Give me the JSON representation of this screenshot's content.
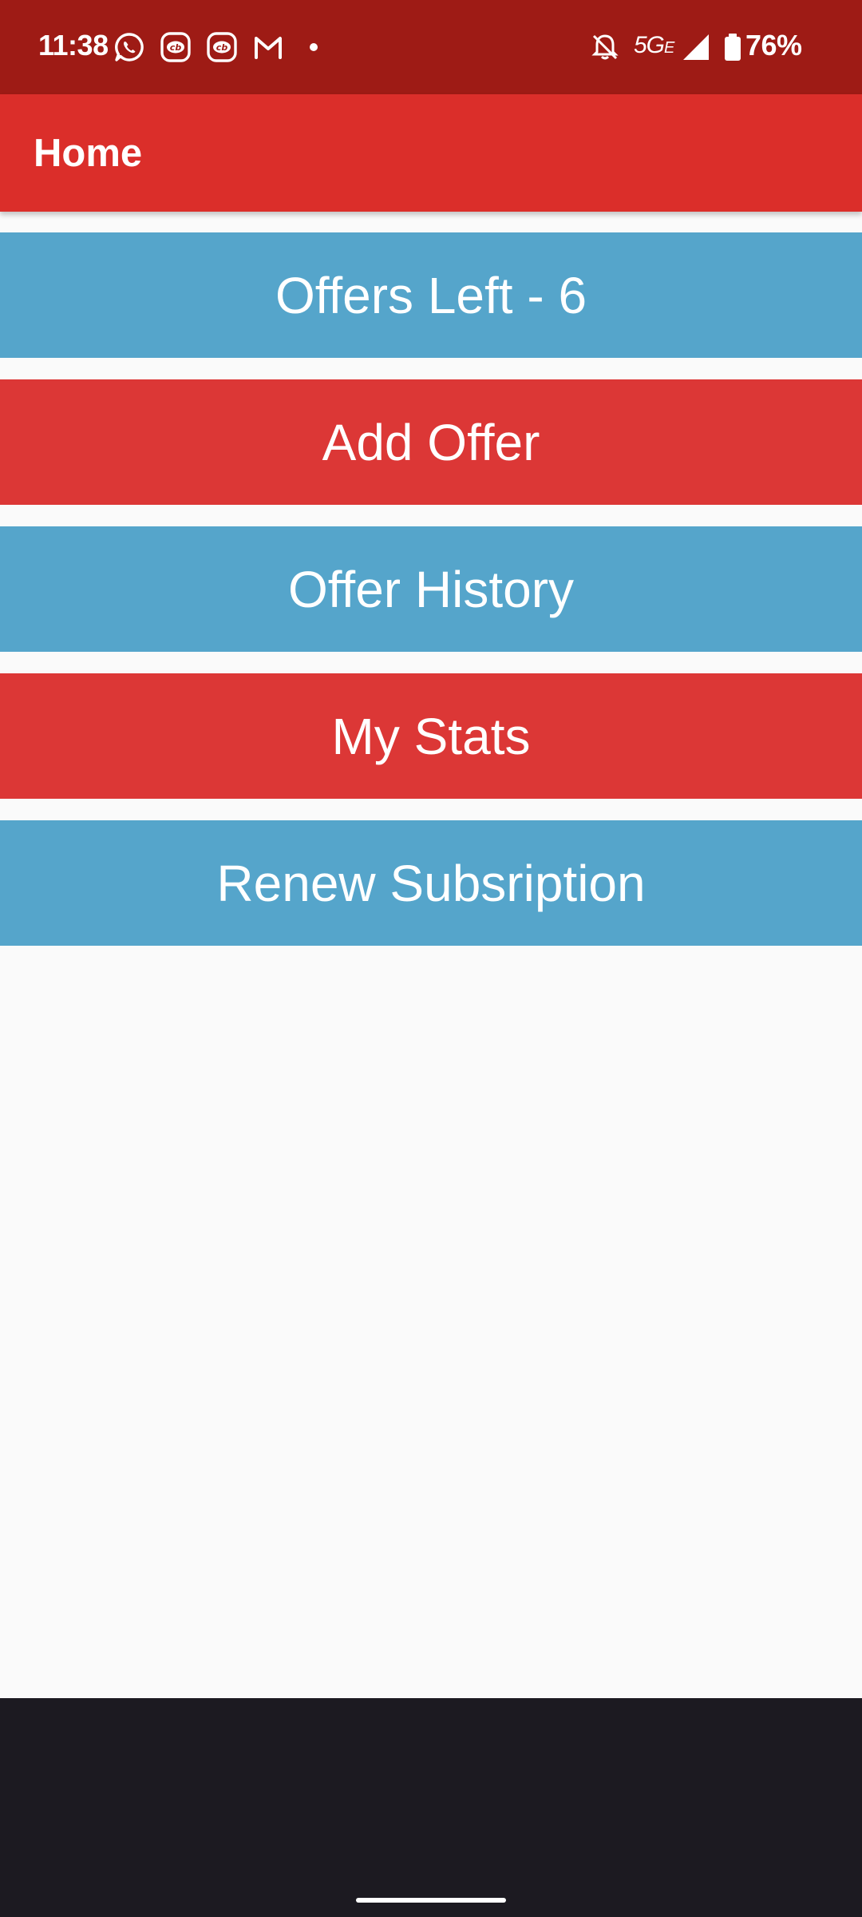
{
  "status_bar": {
    "time": "11:38",
    "network": "5G",
    "network_suffix": "E",
    "battery": "76%",
    "left_icons": [
      "whatsapp-icon",
      "cb-app-icon",
      "cb-app-icon",
      "gmail-icon",
      "more-dot-icon"
    ],
    "right_icons": [
      "bell-off-icon",
      "signal-icon",
      "battery-icon"
    ]
  },
  "app_bar": {
    "title": "Home"
  },
  "menu": {
    "items": [
      {
        "label": "Offers Left - 6",
        "color": "#55a5cb"
      },
      {
        "label": "Add Offer",
        "color": "#dc3736"
      },
      {
        "label": "Offer History",
        "color": "#55a5cb"
      },
      {
        "label": "My Stats",
        "color": "#dc3736"
      },
      {
        "label": "Renew Subsription",
        "color": "#55a5cb"
      }
    ]
  },
  "colors": {
    "status_bar": "#9e1b15",
    "app_bar": "#db2e2a",
    "background": "#fafafa",
    "nav_area": "#1c1a21"
  }
}
